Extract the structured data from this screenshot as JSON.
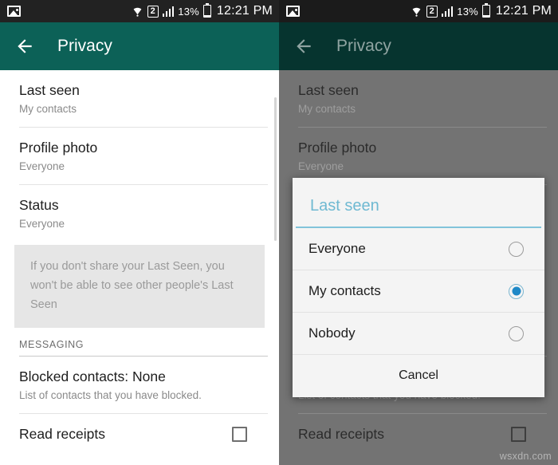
{
  "status_bar": {
    "photo_icon": "photo-icon",
    "wifi_icon": "wifi-icon",
    "sim_badge": "2",
    "signal_icon": "signal-bars-icon",
    "battery_percent": "13%",
    "battery_icon": "battery-icon",
    "clock": "12:21 PM"
  },
  "app_bar": {
    "back_icon": "back-arrow-icon",
    "title": "Privacy"
  },
  "settings": {
    "rows": [
      {
        "title": "Last seen",
        "sub": "My contacts"
      },
      {
        "title": "Profile photo",
        "sub": "Everyone"
      },
      {
        "title": "Status",
        "sub": "Everyone"
      }
    ],
    "info_text": "If you don't share your Last Seen, you won't be able to see other people's Last Seen",
    "section_header": "MESSAGING",
    "blocked": {
      "title": "Blocked contacts: None",
      "sub": "List of contacts that you have blocked."
    },
    "read_receipts": {
      "title": "Read receipts",
      "checked": false
    }
  },
  "dialog": {
    "title": "Last seen",
    "options": [
      {
        "label": "Everyone",
        "selected": false
      },
      {
        "label": "My contacts",
        "selected": true
      },
      {
        "label": "Nobody",
        "selected": false
      }
    ],
    "cancel_label": "Cancel"
  },
  "watermark": "wsxdn.com",
  "colors": {
    "appbar_teal": "#0c6157",
    "appbar_teal_dim": "#06342f",
    "dialog_title_blue": "#6fb9d2",
    "radio_selected_blue": "#1e88c7",
    "scrim_gray": "#737373"
  }
}
